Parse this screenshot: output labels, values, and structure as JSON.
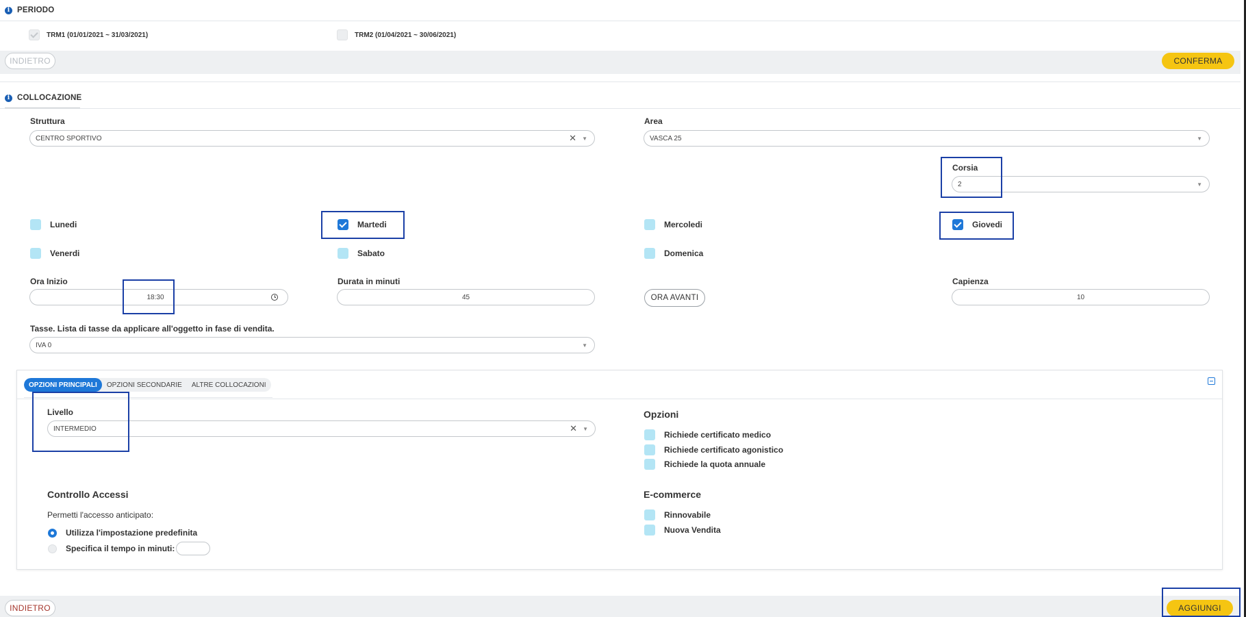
{
  "periodo": {
    "title": "PERIODO",
    "items": [
      {
        "label": "TRM1 (01/01/2021 ~ 31/03/2021)",
        "checked": true
      },
      {
        "label": "TRM2 (01/04/2021 ~ 30/06/2021)",
        "checked": false
      }
    ],
    "back_label": "INDIETRO",
    "confirm_label": "CONFERMA"
  },
  "collocazione": {
    "title": "COLLOCAZIONE",
    "struttura": {
      "label": "Struttura",
      "value": "CENTRO SPORTIVO"
    },
    "area": {
      "label": "Area",
      "value": "VASCA 25"
    },
    "corsia": {
      "label": "Corsia",
      "value": "2"
    },
    "days": [
      {
        "label": "Lunedi",
        "checked": false
      },
      {
        "label": "Martedi",
        "checked": true
      },
      {
        "label": "Mercoledi",
        "checked": false
      },
      {
        "label": "Giovedi",
        "checked": true
      },
      {
        "label": "Venerdi",
        "checked": false
      },
      {
        "label": "Sabato",
        "checked": false
      },
      {
        "label": "Domenica",
        "checked": false
      }
    ],
    "ora_inizio": {
      "label": "Ora Inizio",
      "value": "18:30"
    },
    "durata": {
      "label": "Durata in minuti",
      "value": "45"
    },
    "ora_avanti_label": "ORA AVANTI",
    "capienza": {
      "label": "Capienza",
      "value": "10"
    },
    "tasse": {
      "label": "Tasse. Lista di tasse da applicare all'oggetto in fase di vendita.",
      "value": "IVA 0"
    }
  },
  "options_panel": {
    "tabs": [
      "OPZIONI PRINCIPALI",
      "OPZIONI SECONDARIE",
      "ALTRE COLLOCAZIONI"
    ],
    "active_tab": 0,
    "livello": {
      "label": "Livello",
      "value": "INTERMEDIO"
    },
    "opzioni": {
      "title": "Opzioni",
      "items": [
        "Richiede certificato medico",
        "Richiede certificato agonistico",
        "Richiede la quota annuale"
      ]
    },
    "controllo_accessi": {
      "title": "Controllo Accessi",
      "subtitle": "Permetti l'accesso anticipato:",
      "options": [
        "Utilizza l'impostazione predefinita",
        "Specifica il tempo in minuti:"
      ],
      "selected": 0
    },
    "ecommerce": {
      "title": "E-commerce",
      "items": [
        "Rinnovabile",
        "Nuova Vendita"
      ]
    }
  },
  "footer": {
    "back_label": "INDIETRO",
    "add_label": "AGGIUNGI"
  },
  "colors": {
    "accent": "#1e78d8",
    "yellow": "#f5c512",
    "checkbox_off": "#b3e5f5",
    "highlight": "#1a3fa6"
  }
}
